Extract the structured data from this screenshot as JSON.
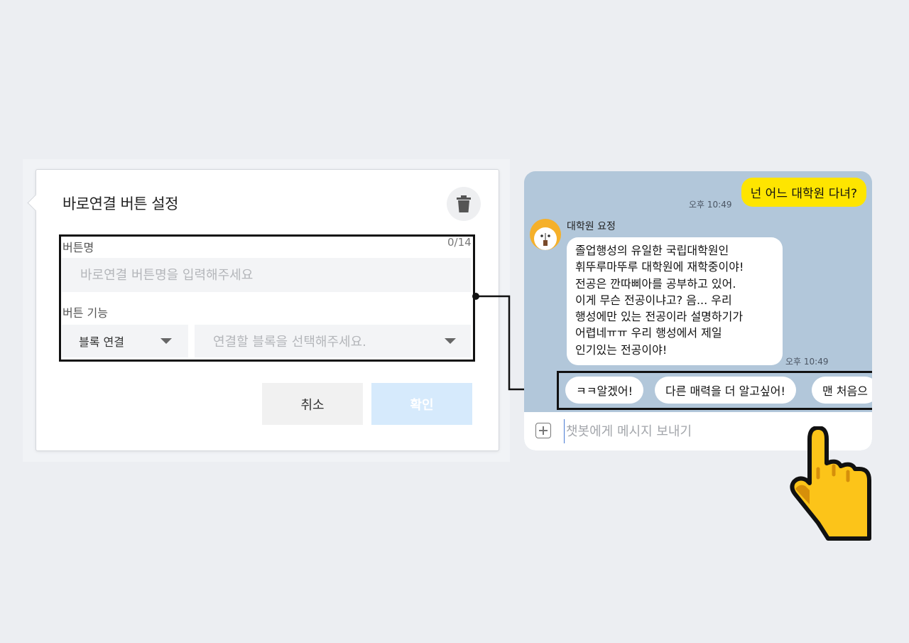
{
  "dialog": {
    "title": "바로연결 버튼 설정",
    "trash_icon": "trash-icon",
    "name_label": "버튼명",
    "name_counter": "0/14",
    "name_placeholder": "바로연결 버튼명을 입력해주세요",
    "function_label": "버튼 기능",
    "function_select": "블록 연결",
    "block_select_placeholder": "연결할 블록을 선택해주세요.",
    "cancel_label": "취소",
    "confirm_label": "확인"
  },
  "chat": {
    "user_message": "넌 어느 대학원 다녀?",
    "user_time": "오후 10:49",
    "bot_name": "대학원 요정",
    "bot_lines": [
      "졸업행성의 유일한 국립대학원인",
      "휘뚜루마뚜루 대학원에 재학중이야!",
      "전공은 깐따삐아를 공부하고 있어.",
      "이게 무슨 전공이냐고? 음... 우리",
      "행성에만 있는 전공이라 설명하기가",
      "어렵네ㅠㅠ 우리 행성에서 제일",
      "인기있는 전공이야!"
    ],
    "bot_time": "오후 10:49",
    "quick_replies": [
      "ㅋㅋ알겠어!",
      "다른 매력을 더 알고싶어!",
      "맨 처음으"
    ],
    "input_placeholder": "챗봇에게 메시지 보내기"
  },
  "colors": {
    "chat_background": "#b2c7da",
    "user_bubble": "#fee500",
    "confirm_button": "#d6eafc",
    "hand_cursor": "#fcc419"
  }
}
